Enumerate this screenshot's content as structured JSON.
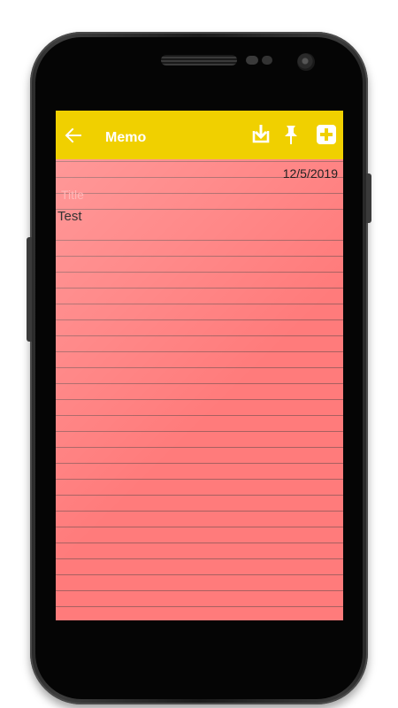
{
  "toolbar": {
    "title": "Memo",
    "background_color": "#f0d000",
    "icons": {
      "back": "arrow-left-icon",
      "save": "save-download-icon",
      "pin": "pin-icon",
      "add": "add-plus-icon"
    }
  },
  "memo": {
    "date": "12/5/2019",
    "title_placeholder": "Title",
    "body": "Test",
    "paper_color": "#ff7b7b",
    "line_color": "#a86060"
  }
}
